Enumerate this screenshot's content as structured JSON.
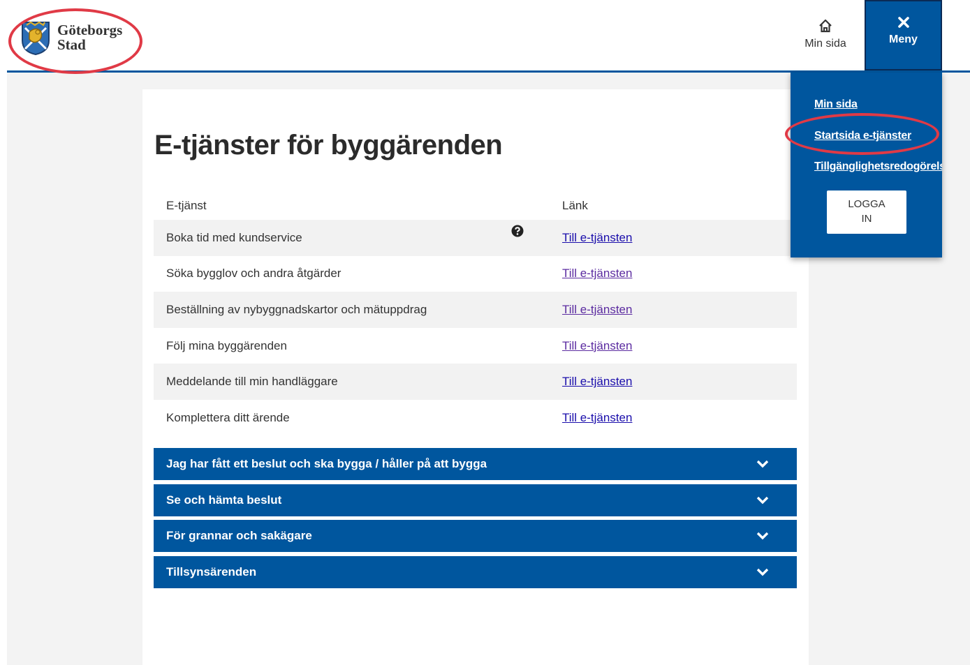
{
  "header": {
    "logo_line1": "Göteborgs",
    "logo_line2": "Stad",
    "min_sida_label": "Min sida",
    "meny_label": "Meny",
    "brand_color": "#00569e",
    "highlight_color": "#e03a46"
  },
  "main": {
    "title": "E-tjänster för byggärenden",
    "table": {
      "headers": [
        "E-tjänst",
        "Länk"
      ],
      "rows": [
        {
          "name": "Boka tid med kundservice",
          "link": "Till e-tjänsten",
          "has_help_icon": true
        },
        {
          "name": "Söka bygglov och andra åtgärder",
          "link": "Till e-tjänsten"
        },
        {
          "name": "Beställning av nybyggnadskartor och mätuppdrag",
          "link": "Till e-tjänsten"
        },
        {
          "name": "Följ mina byggärenden",
          "link": "Till e-tjänsten"
        },
        {
          "name": "Meddelande till min handläggare",
          "link": "Till e-tjänsten"
        },
        {
          "name": "Komplettera ditt ärende",
          "link": "Till e-tjänsten"
        }
      ]
    },
    "accordions": [
      "Jag har fått ett beslut och ska bygga / håller på att bygga",
      "Se och hämta beslut",
      "För grannar och sakägare",
      "Tillsynsärenden"
    ]
  },
  "menu": {
    "items": [
      "Min sida",
      "Startsida e-tjänster",
      "Tillgänglighetsredogörelse"
    ],
    "login_line1": "LOGGA",
    "login_line2": "IN"
  }
}
